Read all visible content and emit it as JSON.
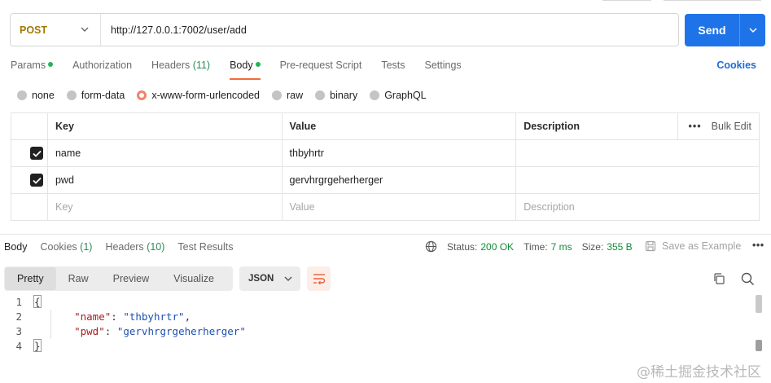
{
  "request": {
    "method": "POST",
    "url": "http://127.0.0.1:7002/user/add",
    "send_label": "Send"
  },
  "tabs": {
    "params": "Params",
    "authorization": "Authorization",
    "headers": "Headers",
    "headers_count": "(11)",
    "body": "Body",
    "prerequest": "Pre-request Script",
    "tests": "Tests",
    "settings": "Settings",
    "cookies": "Cookies"
  },
  "body_types": {
    "none": "none",
    "form_data": "form-data",
    "urlencoded": "x-www-form-urlencoded",
    "raw": "raw",
    "binary": "binary",
    "graphql": "GraphQL",
    "selected": "x-www-form-urlencoded"
  },
  "table": {
    "headers": {
      "key": "Key",
      "value": "Value",
      "description": "Description",
      "bulk_edit": "Bulk Edit"
    },
    "rows": [
      {
        "key": "name",
        "value": "thbyhrtr",
        "checked": true
      },
      {
        "key": "pwd",
        "value": "gervhrgrgeherherger",
        "checked": true
      }
    ],
    "placeholders": {
      "key": "Key",
      "value": "Value",
      "description": "Description"
    }
  },
  "response": {
    "tabs": {
      "body": "Body",
      "cookies": "Cookies",
      "cookies_count": "(1)",
      "headers": "Headers",
      "headers_count": "(10)",
      "test_results": "Test Results"
    },
    "status_label": "Status:",
    "status_value": "200 OK",
    "time_label": "Time:",
    "time_value": "7 ms",
    "size_label": "Size:",
    "size_value": "355 B",
    "save_example": "Save as Example",
    "views": {
      "pretty": "Pretty",
      "raw": "Raw",
      "preview": "Preview",
      "visualize": "Visualize"
    },
    "format": "JSON",
    "code": {
      "line_numbers": [
        "1",
        "2",
        "3",
        "4"
      ],
      "open_brace": "{",
      "close_brace": "}",
      "lines": [
        {
          "key": "\"name\"",
          "value": "\"thbyhrtr\"",
          "trail": ","
        },
        {
          "key": "\"pwd\"",
          "value": "\"gervhrgrgeherherger\"",
          "trail": ""
        }
      ]
    }
  },
  "watermark": "@稀土掘金技术社区",
  "colors": {
    "accent": "#1f73e8",
    "method": "#a07a00",
    "active_tab": "#f26b3a",
    "status_ok": "#128c3a",
    "json_key": "#a41f1f",
    "json_string": "#1f4fb0"
  }
}
